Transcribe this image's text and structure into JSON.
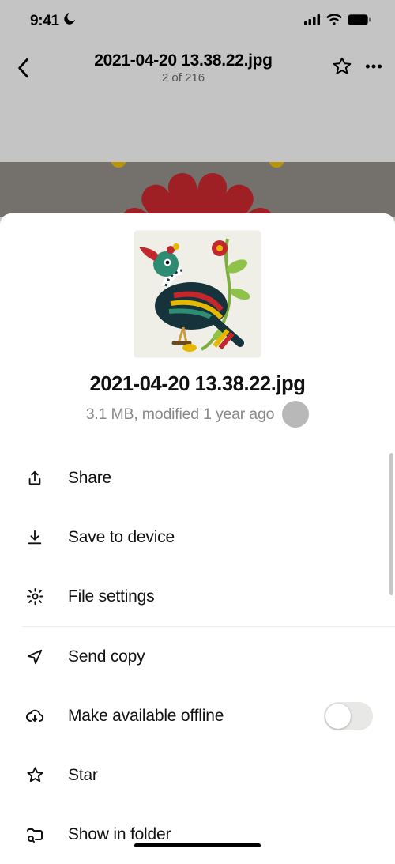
{
  "status": {
    "time": "9:41"
  },
  "nav": {
    "title": "2021-04-20 13.38.22.jpg",
    "subtitle": "2 of 216"
  },
  "sheet": {
    "title": "2021-04-20 13.38.22.jpg",
    "meta": "3.1 MB, modified 1 year ago"
  },
  "menu": {
    "share": "Share",
    "save": "Save to device",
    "settings": "File settings",
    "sendcopy": "Send copy",
    "offline": "Make available offline",
    "star": "Star",
    "showfolder": "Show in folder"
  },
  "toggles": {
    "offline": false
  }
}
